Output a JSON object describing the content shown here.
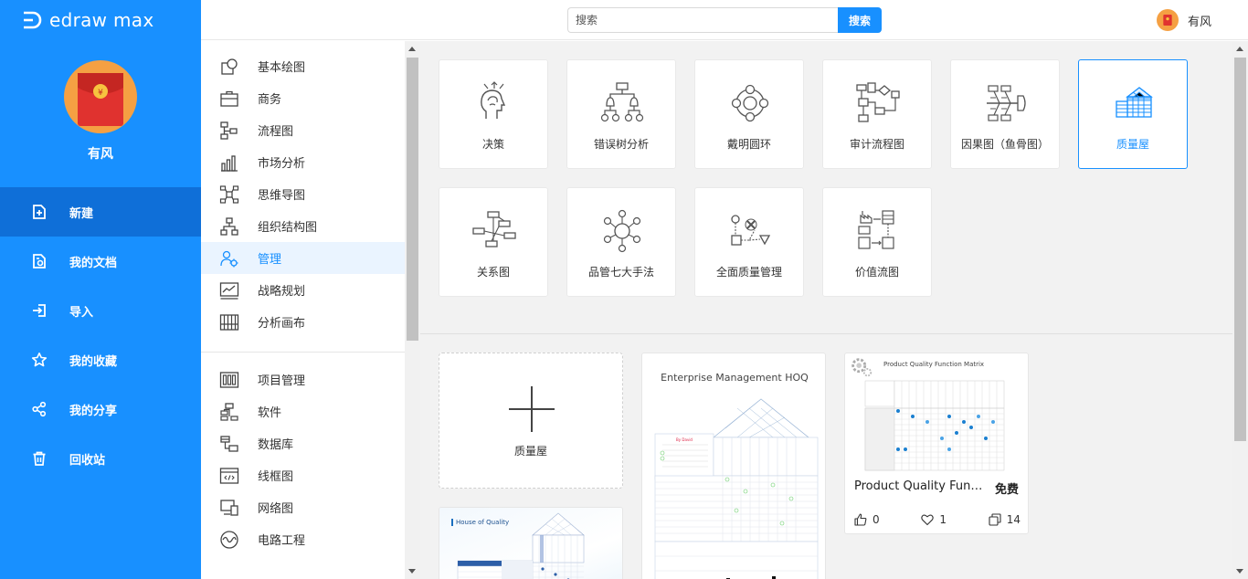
{
  "app": {
    "logo_text": "edraw max"
  },
  "sidebar": {
    "username": "有风",
    "nav": [
      {
        "label": "新建",
        "icon": "new-doc-icon"
      },
      {
        "label": "我的文档",
        "icon": "my-docs-icon"
      },
      {
        "label": "导入",
        "icon": "import-icon"
      },
      {
        "label": "我的收藏",
        "icon": "star-icon"
      },
      {
        "label": "我的分享",
        "icon": "share-icon"
      },
      {
        "label": "回收站",
        "icon": "trash-icon"
      }
    ]
  },
  "topbar": {
    "search_placeholder": "搜索",
    "search_button": "搜索",
    "user_name": "有风"
  },
  "categories": {
    "group1": [
      {
        "label": "基本绘图",
        "icon": "basic-shapes-icon"
      },
      {
        "label": "商务",
        "icon": "briefcase-icon"
      },
      {
        "label": "流程图",
        "icon": "flowchart-icon"
      },
      {
        "label": "市场分析",
        "icon": "bar-chart-icon"
      },
      {
        "label": "思维导图",
        "icon": "mindmap-icon"
      },
      {
        "label": "组织结构图",
        "icon": "org-chart-icon"
      },
      {
        "label": "管理",
        "icon": "management-icon"
      },
      {
        "label": "战略规划",
        "icon": "strategy-icon"
      },
      {
        "label": "分析画布",
        "icon": "canvas-icon"
      }
    ],
    "group2": [
      {
        "label": "项目管理",
        "icon": "project-icon"
      },
      {
        "label": "软件",
        "icon": "software-icon"
      },
      {
        "label": "数据库",
        "icon": "database-icon"
      },
      {
        "label": "线框图",
        "icon": "wireframe-icon"
      },
      {
        "label": "网络图",
        "icon": "network-icon"
      },
      {
        "label": "电路工程",
        "icon": "circuit-icon"
      }
    ]
  },
  "types": [
    {
      "label": "决策",
      "icon": "decision-head-icon"
    },
    {
      "label": "错误树分析",
      "icon": "fault-tree-icon"
    },
    {
      "label": "戴明圆环",
      "icon": "deming-cycle-icon"
    },
    {
      "label": "审计流程图",
      "icon": "audit-flow-icon"
    },
    {
      "label": "因果图（鱼骨图）",
      "icon": "fishbone-icon"
    },
    {
      "label": "质量屋",
      "icon": "house-of-quality-icon"
    },
    {
      "label": "关系图",
      "icon": "relationship-icon"
    },
    {
      "label": "品管七大手法",
      "icon": "seven-tools-icon"
    },
    {
      "label": "全面质量管理",
      "icon": "tqm-icon"
    },
    {
      "label": "价值流图",
      "icon": "value-stream-icon"
    }
  ],
  "templates": {
    "new_label": "质量屋",
    "hoq_thumb_title": "Enterprise Management HOQ",
    "pqf": {
      "thumb_title": "Product Quality Function Matrix",
      "title": "Product Quality Function Matrix",
      "price": "免费",
      "likes": "0",
      "favorites": "1",
      "copies": "14"
    },
    "hoq2_thumb_title": "House of Quality"
  },
  "colors": {
    "accent": "#1890ff",
    "sidebar_active": "#0f6fd8"
  }
}
